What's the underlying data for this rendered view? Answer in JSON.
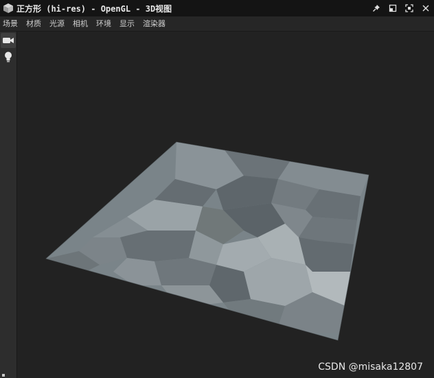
{
  "window": {
    "title": "正方形 (hi-res) - OpenGL - 3D视图"
  },
  "title_controls": {
    "icons": [
      "pin-icon",
      "restore-icon",
      "fullscreen-icon"
    ]
  },
  "menu": {
    "items": [
      "场景",
      "材质",
      "光源",
      "相机",
      "环境",
      "显示",
      "渲染器"
    ]
  },
  "sidebar": {
    "tools": [
      "camera-icon",
      "light-bulb-icon"
    ],
    "active_tool": "camera-icon"
  },
  "viewport": {
    "background": "#222222",
    "surface_color": "#7a8489",
    "watermark": "CSDN @misaka12807"
  }
}
